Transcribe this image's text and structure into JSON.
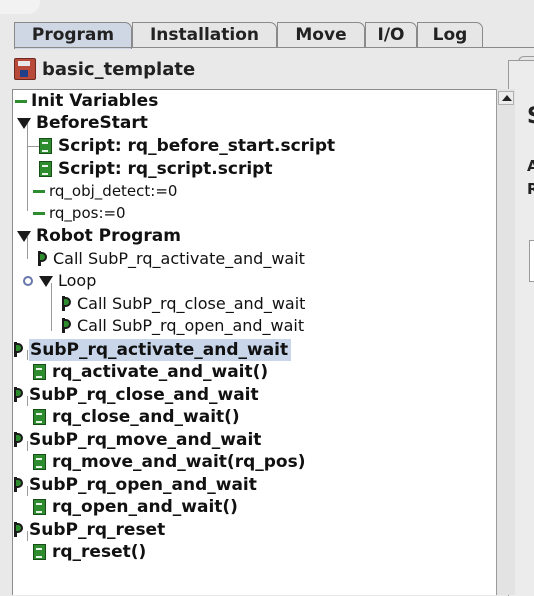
{
  "tabs": [
    {
      "label": "Program",
      "active": true
    },
    {
      "label": "Installation",
      "active": false
    },
    {
      "label": "Move",
      "active": false
    },
    {
      "label": "I/O",
      "active": false
    },
    {
      "label": "Log",
      "active": false
    }
  ],
  "program_name": "basic_template",
  "right_panel_fragments": [
    "S",
    "A",
    "R"
  ],
  "tree": [
    {
      "label": "Init Variables",
      "icon": "variables-icon",
      "bold": true
    },
    {
      "label": "BeforeStart",
      "icon": "expand-triangle-icon",
      "bold": true
    },
    {
      "label": "Script: rq_before_start.script",
      "icon": "script-icon",
      "bold": true
    },
    {
      "label": "Script: rq_script.script",
      "icon": "script-icon",
      "bold": true
    },
    {
      "label": "rq_obj_detect:=0",
      "icon": "assignment-icon",
      "bold": false
    },
    {
      "label": "rq_pos:=0",
      "icon": "assignment-icon",
      "bold": false
    },
    {
      "label": "Robot Program",
      "icon": "expand-triangle-icon",
      "bold": true
    },
    {
      "label": "Call SubP_rq_activate_and_wait",
      "icon": "subprogram-call-icon",
      "bold": false
    },
    {
      "label": "Loop",
      "icon": "expand-triangle-icon",
      "bold": false
    },
    {
      "label": "Call SubP_rq_close_and_wait",
      "icon": "subprogram-call-icon",
      "bold": false
    },
    {
      "label": "Call SubP_rq_open_and_wait",
      "icon": "subprogram-call-icon",
      "bold": false
    },
    {
      "label": "SubP_rq_activate_and_wait",
      "icon": "subprogram-icon",
      "bold": true,
      "selected": true
    },
    {
      "label": "rq_activate_and_wait()",
      "icon": "script-icon",
      "bold": true
    },
    {
      "label": "SubP_rq_close_and_wait",
      "icon": "subprogram-icon",
      "bold": true
    },
    {
      "label": "rq_close_and_wait()",
      "icon": "script-icon",
      "bold": true
    },
    {
      "label": "SubP_rq_move_and_wait",
      "icon": "subprogram-icon",
      "bold": true
    },
    {
      "label": "rq_move_and_wait(rq_pos)",
      "icon": "script-icon",
      "bold": true
    },
    {
      "label": "SubP_rq_open_and_wait",
      "icon": "subprogram-icon",
      "bold": true
    },
    {
      "label": "rq_open_and_wait()",
      "icon": "script-icon",
      "bold": true
    },
    {
      "label": "SubP_rq_reset",
      "icon": "subprogram-icon",
      "bold": true
    },
    {
      "label": "rq_reset()",
      "icon": "script-icon",
      "bold": true
    }
  ]
}
